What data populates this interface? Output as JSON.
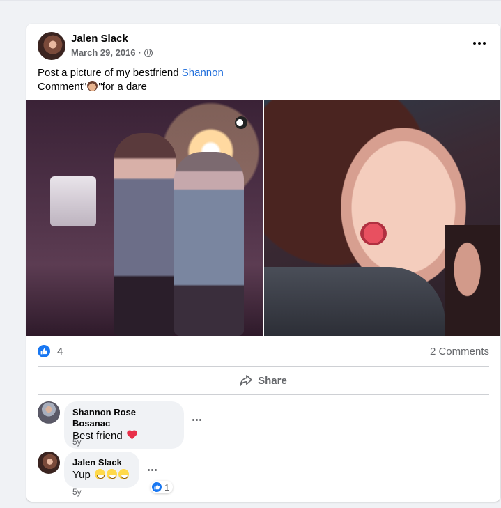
{
  "post": {
    "author": "Jalen Slack",
    "date": "March 29, 2016",
    "separator": "·",
    "privacy_icon": "globe-icon",
    "more_icon": "more-horizontal-icon",
    "text_line1": "Post a picture of my bestfriend ",
    "tagged_name": "Shannon",
    "text_line2_prefix": "Comment\"",
    "text_line2_suffix": "\"for a dare",
    "photo_count": 2
  },
  "stats": {
    "reaction_icon": "like-icon",
    "reaction_count": "4",
    "comments_label": "2 Comments"
  },
  "actions": {
    "share_label": "Share",
    "share_icon": "share-arrow-icon"
  },
  "comments": [
    {
      "author": "Shannon Rose Bosanac",
      "text": "Best friend",
      "emoji": "heart-emoji",
      "time": "5y"
    },
    {
      "author": "Jalen Slack",
      "text": "Yup",
      "emoji": "grin-emoji",
      "time": "5y",
      "reaction_count": "1"
    }
  ],
  "colors": {
    "link": "#216fdb",
    "like_blue": "#1877f2",
    "secondary_text": "#65676b",
    "bubble_bg": "#f0f2f5"
  }
}
